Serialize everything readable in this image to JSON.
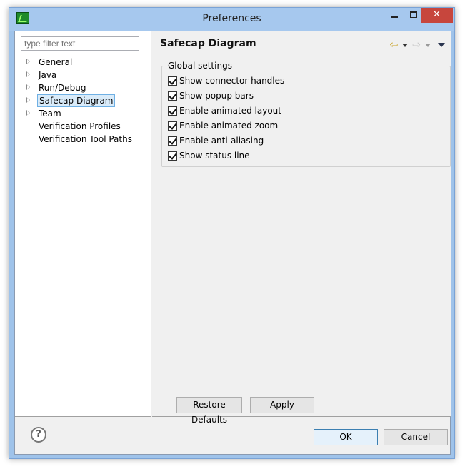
{
  "window": {
    "title": "Preferences",
    "app_icon": "eclipse-icon"
  },
  "controls": {
    "minimize": "minimize-icon",
    "maximize": "maximize-icon",
    "close_label": "✕"
  },
  "filter": {
    "placeholder": "type filter text",
    "value": ""
  },
  "tree": {
    "items": [
      {
        "label": "General",
        "expandable": true,
        "selected": false
      },
      {
        "label": "Java",
        "expandable": true,
        "selected": false
      },
      {
        "label": "Run/Debug",
        "expandable": true,
        "selected": false
      },
      {
        "label": "Safecap Diagram",
        "expandable": true,
        "selected": true
      },
      {
        "label": "Team",
        "expandable": true,
        "selected": false
      },
      {
        "label": "Verification Profiles",
        "expandable": false,
        "selected": false
      },
      {
        "label": "Verification Tool Paths",
        "expandable": false,
        "selected": false
      }
    ]
  },
  "page": {
    "title": "Safecap Diagram",
    "nav": {
      "back_icon": "back-arrow-icon",
      "forward_icon": "forward-arrow-icon",
      "menu_icon": "view-menu-icon"
    },
    "group": {
      "label": "Global settings",
      "options": [
        {
          "label": "Show connector handles",
          "checked": true
        },
        {
          "label": "Show popup bars",
          "checked": true
        },
        {
          "label": "Enable animated layout",
          "checked": true
        },
        {
          "label": "Enable animated zoom",
          "checked": true
        },
        {
          "label": "Enable anti-aliasing",
          "checked": true
        },
        {
          "label": "Show status line",
          "checked": true
        }
      ]
    },
    "restore_defaults_label": "Restore Defaults",
    "apply_label": "Apply"
  },
  "footer": {
    "help_label": "?",
    "ok_label": "OK",
    "cancel_label": "Cancel"
  }
}
